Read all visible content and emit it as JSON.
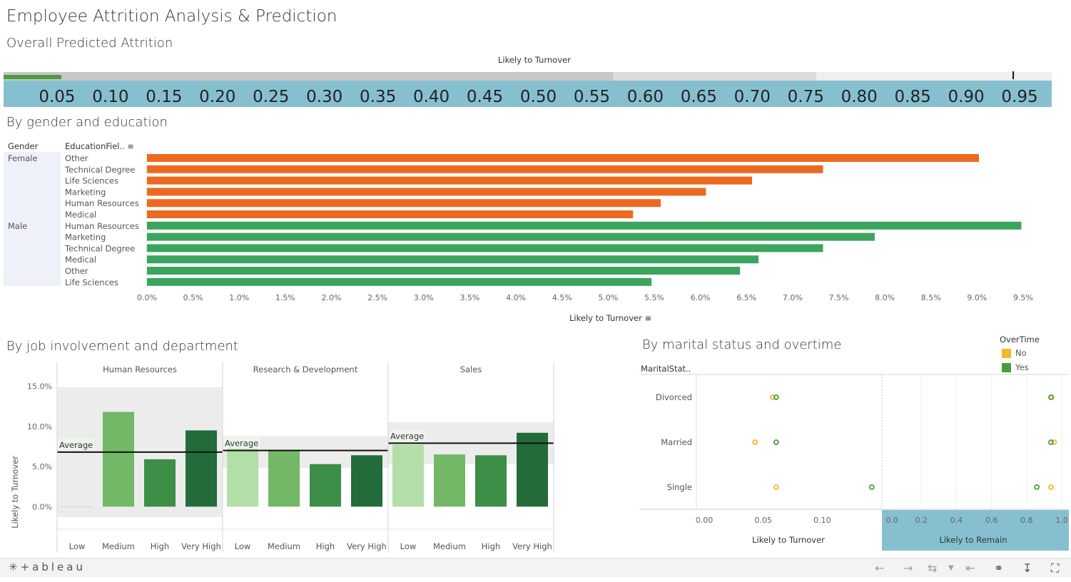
{
  "title": "Employee Attrition Analysis & Prediction",
  "overall": {
    "title": "Overall Predicted Attrition",
    "axis_label": "Likely to Turnover",
    "ticks": [
      "0.05",
      "0.10",
      "0.15",
      "0.20",
      "0.25",
      "0.30",
      "0.35",
      "0.40",
      "0.45",
      "0.50",
      "0.55",
      "0.60",
      "0.65",
      "0.70",
      "0.75",
      "0.80",
      "0.85",
      "0.90",
      "0.95"
    ],
    "value": 0.054,
    "bands": [
      0.57,
      0.76,
      1.0
    ],
    "marker": 0.944,
    "colors": {
      "measure": "#4f9a43",
      "band1": "#c8c8c8",
      "band2": "#dcdcdc",
      "band3": "#efefef",
      "axis_bg": "#86c0d0"
    }
  },
  "gender": {
    "title": "By gender and education",
    "col_gender": "Gender",
    "col_field": "EducationFiel..",
    "xlabel": "Likely to Turnover",
    "groups": [
      "Female",
      "Male"
    ]
  },
  "job": {
    "title": "By job involvement and department",
    "ylabel": "Likely to Turnover",
    "avg_label": "Average",
    "yticks": [
      "15.0%",
      "10.0%",
      "5.0%",
      "0.0%"
    ]
  },
  "marital": {
    "title": "By marital status and overtime",
    "col_header": "MaritalStat..",
    "legend_title": "OverTime",
    "legend": [
      {
        "label": "No",
        "color": "#f2b92b"
      },
      {
        "label": "Yes",
        "color": "#4c9a3f"
      }
    ],
    "xlabel_left": "Likely to Turnover",
    "xlabel_right": "Likely to Remain",
    "ticks_left": [
      "0.00",
      "0.05",
      "0.10"
    ],
    "ticks_right": [
      "0.0",
      "0.2",
      "0.4",
      "0.6",
      "0.8",
      "1.0"
    ]
  },
  "chart_data": [
    {
      "type": "bar",
      "title": "Overall Predicted Attrition",
      "xlabel": "Likely to Turnover",
      "values": [
        0.054
      ],
      "xlim": [
        0.0,
        0.98
      ]
    },
    {
      "type": "bar",
      "title": "By gender and education",
      "xlabel": "Likely to Turnover",
      "xlim": [
        0,
        9.8
      ],
      "x_ticks": [
        "0.0%",
        "0.5%",
        "1.0%",
        "1.5%",
        "2.0%",
        "2.5%",
        "3.0%",
        "3.5%",
        "4.0%",
        "4.5%",
        "5.0%",
        "5.5%",
        "6.0%",
        "6.5%",
        "7.0%",
        "7.5%",
        "8.0%",
        "8.5%",
        "9.0%",
        "9.5%"
      ],
      "series": [
        {
          "name": "Female",
          "color": "#ec6a1f",
          "categories": [
            "Other",
            "Technical Degree",
            "Life Sciences",
            "Marketing",
            "Human Resources",
            "Medical"
          ],
          "values": [
            9.02,
            7.33,
            6.56,
            6.06,
            5.57,
            5.27
          ]
        },
        {
          "name": "Male",
          "color": "#3aa55c",
          "categories": [
            "Human Resources",
            "Marketing",
            "Technical Degree",
            "Medical",
            "Other",
            "Life Sciences"
          ],
          "values": [
            9.48,
            7.89,
            7.33,
            6.63,
            6.43,
            5.47
          ]
        }
      ]
    },
    {
      "type": "bar",
      "title": "By job involvement and department",
      "ylabel": "Likely to Turnover",
      "ylim": [
        -1.3,
        15.4
      ],
      "categories": [
        "Low",
        "Medium",
        "High",
        "Very High"
      ],
      "colors": [
        "#b2dfa8",
        "#72b866",
        "#3d8e46",
        "#236b3b"
      ],
      "series": [
        {
          "name": "Human Resources",
          "values": [
            0.0,
            11.8,
            5.9,
            9.5
          ],
          "average": 6.8,
          "band": [
            -1.3,
            14.9
          ]
        },
        {
          "name": "Research & Development",
          "values": [
            7.5,
            7.1,
            5.3,
            6.4
          ],
          "average": 7.0,
          "band": [
            4.8,
            8.8
          ]
        },
        {
          "name": "Sales",
          "values": [
            7.7,
            6.5,
            6.4,
            9.2
          ],
          "average": 7.9,
          "band": [
            5.3,
            10.5
          ]
        }
      ]
    },
    {
      "type": "scatter",
      "title": "By marital status and overtime",
      "categories": [
        "Divorced",
        "Married",
        "Single"
      ],
      "series": [
        {
          "name": "No",
          "turnover": [
            0.058,
            0.043,
            0.061
          ],
          "remain": [
            0.942,
            0.957,
            0.939
          ]
        },
        {
          "name": "Yes",
          "turnover": [
            0.061,
            0.061,
            0.142
          ],
          "remain": [
            0.939,
            0.939,
            0.858
          ]
        }
      ]
    }
  ]
}
